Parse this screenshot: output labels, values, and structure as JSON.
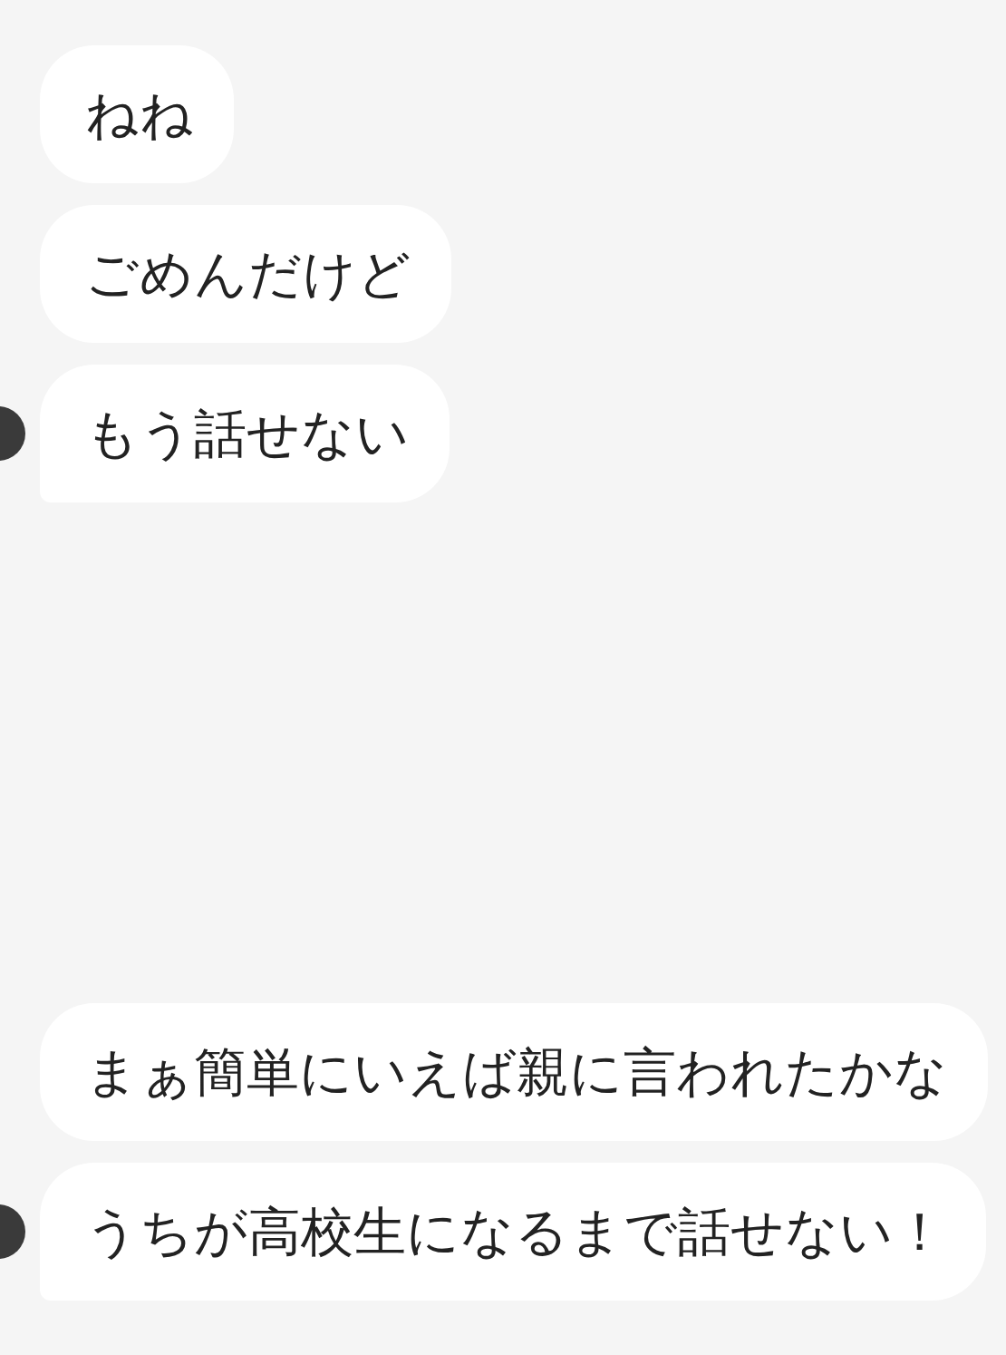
{
  "message_groups": [
    {
      "messages": [
        {
          "text": "ねね"
        },
        {
          "text": "ごめんだけど"
        },
        {
          "text": "もう話せない"
        }
      ]
    },
    {
      "messages": [
        {
          "text": "まぁ簡単にいえば親に言われたかな"
        },
        {
          "text": "うちが高校生になるまで話せない！"
        }
      ]
    }
  ]
}
